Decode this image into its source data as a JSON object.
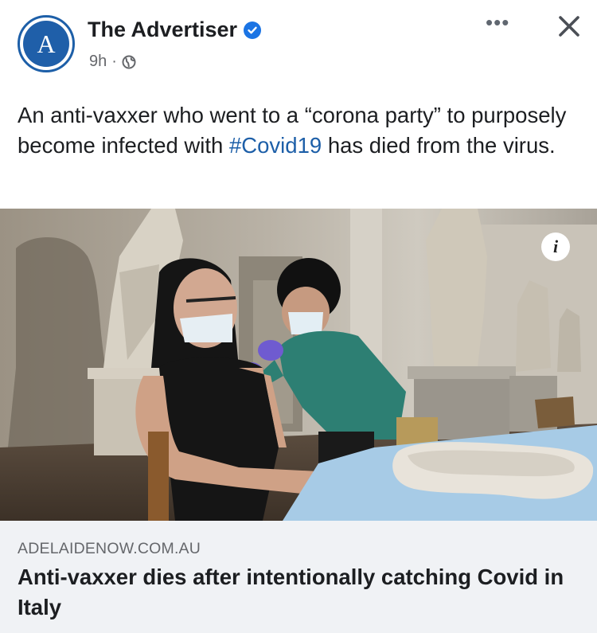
{
  "header": {
    "avatar_letter": "A",
    "page_name": "The Advertiser",
    "time": "9h",
    "separator": "·",
    "more_label": "•••"
  },
  "post": {
    "text_before": "An anti-vaxxer who went to a “corona party” to purposely become infected with ",
    "hashtag": "#Covid19",
    "text_after": " has died from the virus."
  },
  "photo": {
    "info_label": "i"
  },
  "link_preview": {
    "domain": "ADELAIDENOW.COM.AU",
    "headline": "Anti-vaxxer dies after intentionally catching Covid in Italy"
  },
  "colors": {
    "brand_blue": "#1d5fa8",
    "verified_blue": "#1b74e4",
    "link_box_bg": "#f0f2f5",
    "secondary_text": "#65676b"
  }
}
